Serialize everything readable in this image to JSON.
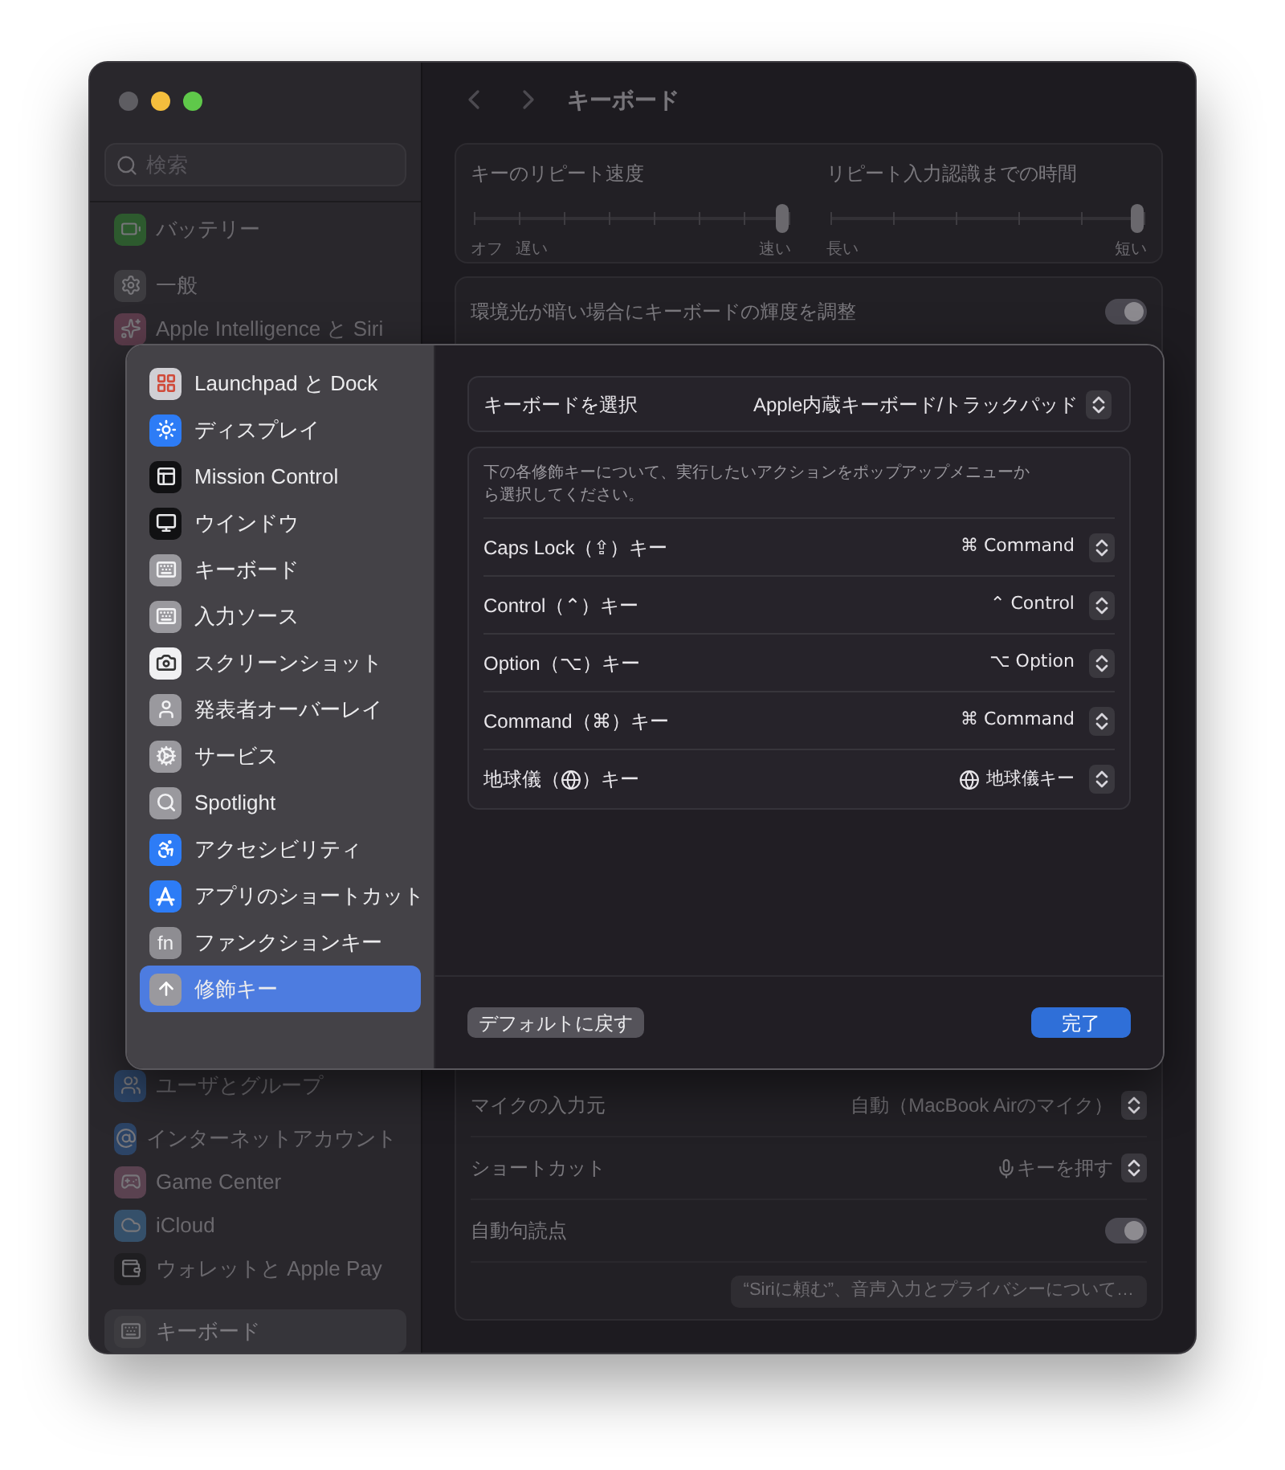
{
  "sidebar": {
    "search": {
      "placeholder": "検索"
    },
    "top_groups": [
      [
        {
          "label": "バッテリー",
          "selected": false
        }
      ],
      [
        {
          "label": "一般",
          "selected": false
        },
        {
          "label": "Apple Intelligence と Siri",
          "selected": false
        }
      ]
    ],
    "bottom_groups": [
      [
        {
          "label": "ユーザとグループ",
          "selected": false
        }
      ],
      [
        {
          "label": "インターネットアカウント",
          "selected": false
        },
        {
          "label": "Game Center",
          "selected": false
        },
        {
          "label": "iCloud",
          "selected": false
        },
        {
          "label": "ウォレットと Apple Pay",
          "selected": false
        }
      ],
      [
        {
          "label": "キーボード",
          "selected": true
        }
      ]
    ]
  },
  "page": {
    "title": "キーボード",
    "sliders": [
      {
        "label": "キーのリピート速度",
        "level": 1,
        "left_labels": [
          "オフ",
          "遅い"
        ],
        "right_label": "速い"
      },
      {
        "label": "リピート入力認識までの時間",
        "level": 1,
        "left_labels": [
          "長い"
        ],
        "right_label": "短い"
      }
    ],
    "backlight": {
      "label": "環境光が暗い場合にキーボードの輝度を調整",
      "on": true
    },
    "dictation_rows": [
      {
        "kind": "popup",
        "label": "マイクの入力元",
        "value": "自動（MacBook Airのマイク）"
      },
      {
        "kind": "popup_mic",
        "label": "ショートカット",
        "value": "キーを押す"
      },
      {
        "kind": "toggle",
        "label": "自動句読点",
        "on": true
      }
    ],
    "about_button": "“Siriに頼む”、音声入力とプライバシーについて…"
  },
  "sheet": {
    "nav": [
      {
        "label": "Launchpad と Dock",
        "selected": false
      },
      {
        "label": "ディスプレイ",
        "selected": false
      },
      {
        "label": "Mission Control",
        "selected": false
      },
      {
        "label": "ウインドウ",
        "selected": false
      },
      {
        "label": "キーボード",
        "selected": false
      },
      {
        "label": "入力ソース",
        "selected": false
      },
      {
        "label": "スクリーンショット",
        "selected": false
      },
      {
        "label": "発表者オーバーレイ",
        "selected": false
      },
      {
        "label": "サービス",
        "selected": false
      },
      {
        "label": "Spotlight",
        "selected": false
      },
      {
        "label": "アクセシビリティ",
        "selected": false
      },
      {
        "label": "アプリのショートカット",
        "selected": false
      },
      {
        "label": "ファンクションキー",
        "selected": false,
        "icon_text": "fn"
      },
      {
        "label": "修飾キー",
        "selected": true
      }
    ],
    "keyboard_select": {
      "label": "キーボードを選択",
      "value": "Apple内蔵キーボード/トラックパッド"
    },
    "description": "下の各修飾キーについて、実行したいアクションをポップアップメニューから選択してください。",
    "modifiers": [
      {
        "kind": "plain",
        "label": "Caps Lock（⇪）キー",
        "value": "⌘ Command"
      },
      {
        "kind": "plain",
        "label": "Control（⌃）キー",
        "value": "⌃ Control"
      },
      {
        "kind": "plain",
        "label": "Option（⌥）キー",
        "value": "⌥ Option"
      },
      {
        "kind": "plain",
        "label": "Command（⌘）キー",
        "value": "⌘ Command"
      },
      {
        "kind": "globe",
        "label_start": "地球儀（",
        "label_end": "）キー",
        "value": "地球儀キー"
      }
    ],
    "reset_button": "デフォルトに戻す",
    "done_button": "完了"
  }
}
